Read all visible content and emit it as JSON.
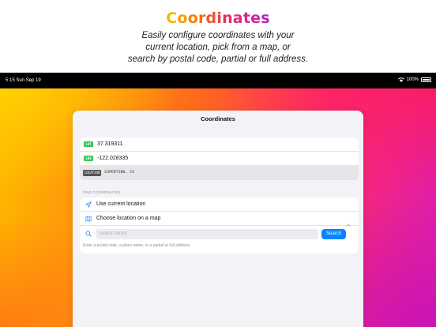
{
  "promo": {
    "title_letters": [
      {
        "ch": "C",
        "color": "#f5b800"
      },
      {
        "ch": "o",
        "color": "#f59e00"
      },
      {
        "ch": "o",
        "color": "#f58200"
      },
      {
        "ch": "r",
        "color": "#f26a1a"
      },
      {
        "ch": "d",
        "color": "#ef5530"
      },
      {
        "ch": "i",
        "color": "#ec3e46"
      },
      {
        "ch": "n",
        "color": "#e82e5c"
      },
      {
        "ch": "a",
        "color": "#e22a74"
      },
      {
        "ch": "t",
        "color": "#d6288c"
      },
      {
        "ch": "e",
        "color": "#c627a6"
      },
      {
        "ch": "s",
        "color": "#b327be"
      }
    ],
    "subtitle_lines": [
      "Easily configure coordinates with your",
      "current location, pick from a map, or",
      "search by postal code, partial or full address."
    ]
  },
  "status_bar": {
    "time_date": "5:15   Sun Sep 19",
    "battery": "100%"
  },
  "sheet": {
    "title": "Coordinates",
    "coordinates": {
      "lat_tag": "LAT",
      "lat_value": "37.319311",
      "lng_tag": "LNG",
      "lng_value": "-122.028335",
      "location_tag": "LOCATION",
      "location_value": "CUPERTINO, CA"
    },
    "find": {
      "section_label": "FIND COORDINATES",
      "use_current": "Use current location",
      "choose_map": "Choose location on a map",
      "search_placeholder": "Search terms",
      "search_button": "Search",
      "help_text": "Enter a postal code, a place name, or a partial or full address."
    }
  },
  "colors": {
    "accent": "#0a84ff",
    "tag_green": "#34c759",
    "location_tag": "#555555"
  },
  "icons": [
    "location-arrow-icon",
    "map-icon",
    "chevron-up-icon",
    "search-icon",
    "wifi-icon",
    "battery-icon"
  ]
}
